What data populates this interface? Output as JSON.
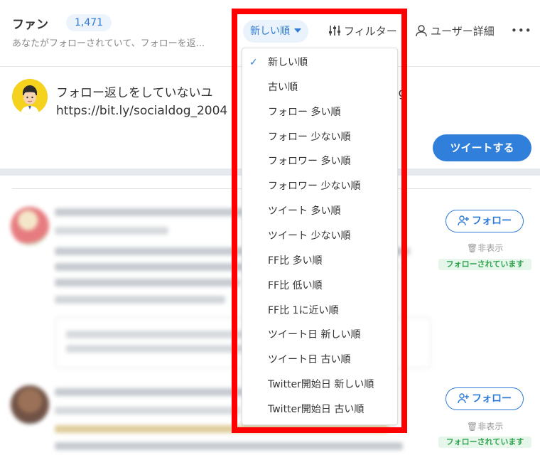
{
  "header": {
    "title": "ファン",
    "count": "1,471",
    "subtitle": "あなたがフォローされていて、フォローを返...",
    "sort_label": "新しい順",
    "filter_label": "フィルター",
    "user_detail_label": "ユーザー詳細",
    "more_label": "•••"
  },
  "compose": {
    "text_line1": "フォロー返しをしていないユ",
    "text_line1_end": "ocialDog",
    "text_line2": "https://bit.ly/socialdog_2004",
    "tweet_button": "ツイートする"
  },
  "sort_menu": {
    "selected_index": 0,
    "check_glyph": "✓",
    "items": [
      "新しい順",
      "古い順",
      "フォロー 多い順",
      "フォロー 少ない順",
      "フォロワー 多い順",
      "フォロワー 少ない順",
      "ツイート 多い順",
      "ツイート 少ない順",
      "FF比 多い順",
      "FF比 低い順",
      "FF比 1に近い順",
      "ツイート日 新しい順",
      "ツイート日 古い順",
      "Twitter開始日 新しい順",
      "Twitter開始日 古い順"
    ]
  },
  "feed": {
    "rows": [
      {
        "follow_label": "フォロー",
        "hide_label": "非表示",
        "status_badge": "フォローされています"
      },
      {
        "follow_label": "フォロー",
        "hide_label": "非表示",
        "status_badge": "フォローされています"
      }
    ]
  },
  "colors": {
    "accent": "#2d7bd4",
    "highlight_border": "#ff0000",
    "followed_green": "#2fa44f"
  },
  "icons": {
    "sort_caret": "chevron-down-icon",
    "filter": "sliders-icon",
    "user": "user-icon",
    "follow": "user-plus-icon",
    "hide": "trash-icon"
  }
}
